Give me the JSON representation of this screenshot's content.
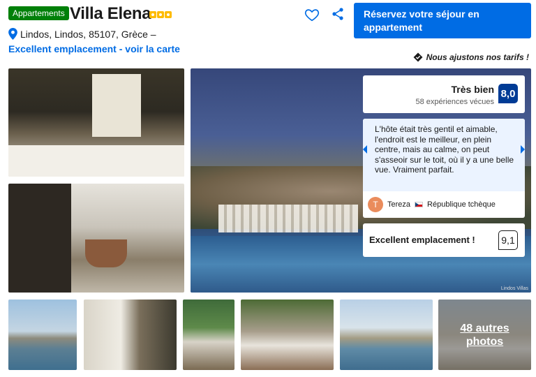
{
  "header": {
    "property_type": "Appartements",
    "title": "Villa Elena",
    "stars": 3,
    "address": "Lindos, Lindos, 85107, Grèce –",
    "location_link": "Excellent emplacement - voir la carte",
    "reserve_button": "Réservez votre séjour en appartement",
    "price_match": "Nous ajustons nos tarifs !"
  },
  "rating": {
    "label": "Très bien",
    "reviews": "58 expériences vécues",
    "score": "8,0"
  },
  "review": {
    "text": "L'hôte était très gentil et aimable, l'endroit est le meilleur, en plein centre, mais au calme, on peut s'asseoir sur le toit, où il y a une belle vue. Vraiment parfait.",
    "avatar_initial": "T",
    "author": "Tereza",
    "country": "République tchèque"
  },
  "location_score": {
    "label": "Excellent emplacement !",
    "score": "9,1"
  },
  "gallery": {
    "main_credit": "Lindos Villas",
    "more_photos": "48 autres photos"
  },
  "colors": {
    "brand_blue": "#006ce4",
    "score_blue": "#003b95",
    "badge_green": "#008009",
    "star_yellow": "#febb02"
  }
}
